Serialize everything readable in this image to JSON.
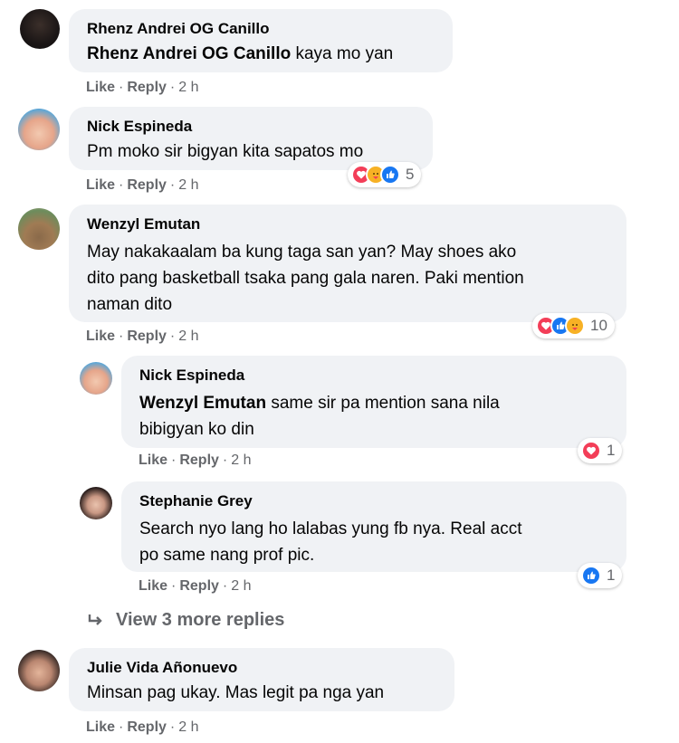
{
  "comments": [
    {
      "author": "Rhenz Andrei OG Canillo",
      "mention": "Rhenz Andrei OG Canillo",
      "text": " kaya mo yan",
      "actions": {
        "like": "Like",
        "reply": "Reply",
        "time": "2 h"
      }
    },
    {
      "author": "Nick Espineda",
      "text": "Pm moko sir bigyan kita sapatos mo",
      "actions": {
        "like": "Like",
        "reply": "Reply",
        "time": "2 h"
      },
      "reactions": {
        "icons": [
          "love-icon",
          "care-icon",
          "like-icon"
        ],
        "count": "5"
      }
    },
    {
      "author": "Wenzyl Emutan",
      "text_lines": [
        "May nakakaalam ba kung taga san yan? May shoes ako",
        "dito pang basketball tsaka pang gala naren. Paki mention",
        "naman dito"
      ],
      "actions": {
        "like": "Like",
        "reply": "Reply",
        "time": "2 h"
      },
      "reactions": {
        "icons": [
          "love-icon",
          "like-icon",
          "care-icon"
        ],
        "count": "10"
      }
    },
    {
      "author": "Julie Vida Añonuevo",
      "text": "Minsan pag ukay. Mas legit pa nga yan",
      "actions": {
        "like": "Like",
        "reply": "Reply",
        "time": "2 h"
      }
    }
  ],
  "replies": [
    {
      "author": "Nick Espineda",
      "mention": "Wenzyl Emutan",
      "text_lines": [
        " same sir pa mention sana nila",
        "bibigyan ko din"
      ],
      "actions": {
        "like": "Like",
        "reply": "Reply",
        "time": "2 h"
      },
      "reactions": {
        "icons": [
          "love-icon"
        ],
        "count": "1"
      }
    },
    {
      "author": "Stephanie Grey",
      "text_lines": [
        "Search nyo lang ho lalabas yung fb nya. Real acct",
        "po same nang prof pic."
      ],
      "actions": {
        "like": "Like",
        "reply": "Reply",
        "time": "2 h"
      },
      "reactions": {
        "icons": [
          "like-icon"
        ],
        "count": "1"
      }
    }
  ],
  "more_replies_label": "View 3 more replies",
  "colors": {
    "bubble": "#f0f2f5",
    "meta": "#65676b",
    "like": "#1877f2",
    "love": "#f33e58",
    "care": "#f7b125"
  }
}
